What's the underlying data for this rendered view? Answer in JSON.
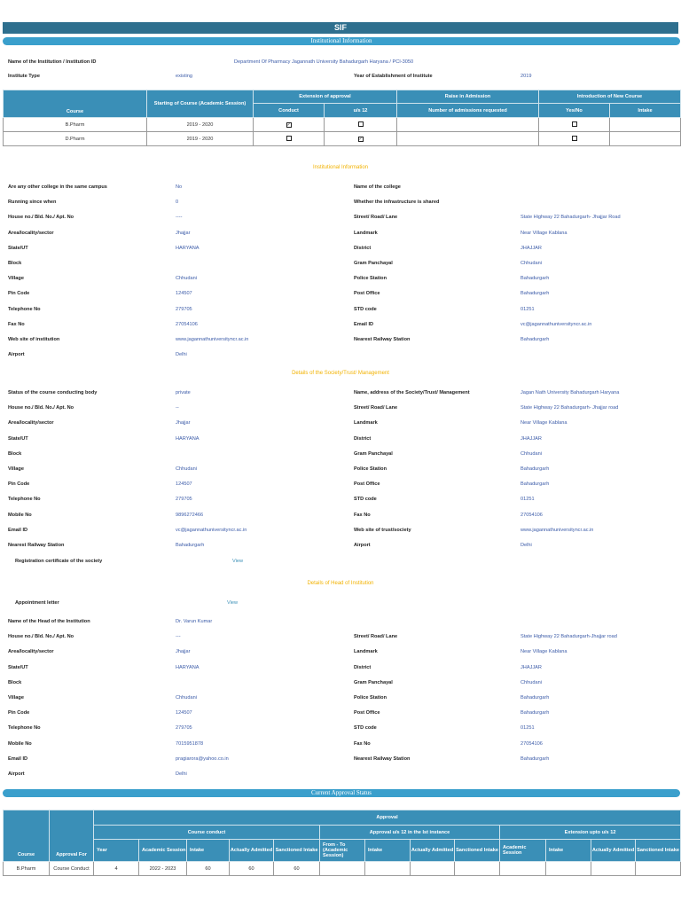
{
  "title": "SIF",
  "sections": {
    "inst_info_bar": "Institutional Information",
    "inst_info_heading": "Institutional Information",
    "society_heading": "Details of the Society/Trust/ Management",
    "head_heading": "Details of Head of Institution",
    "approval_bar": "Current Approval Status"
  },
  "top": {
    "name_label": "Name of the Institution / Institution ID",
    "name_value": "Department Of Pharmacy Jagannath University Bahadurgarh Haryana / PCI-3050",
    "type_label": "Institute Type",
    "type_value": "existing",
    "year_label": "Year of Establishment of Institute",
    "year_value": "2019"
  },
  "course_table": {
    "headers": {
      "course": "Course",
      "starting": "Starting of Course (Academic Session)",
      "extension": "Extension of approval",
      "raise": "Raise in Admission",
      "intro": "Introduction of New Course",
      "conduct": "Conduct",
      "us12": "u/s 12",
      "num": "Number of admissions requested",
      "yesno": "Yes/No",
      "intake": "Intake"
    },
    "rows": [
      {
        "course": "B.Pharm",
        "session": "2019 - 2020",
        "conduct": true,
        "us12": false,
        "num": "",
        "yesno": false,
        "intake": ""
      },
      {
        "course": "D.Pharm",
        "session": "2019 - 2020",
        "conduct": false,
        "us12": true,
        "num": "",
        "yesno": false,
        "intake": ""
      }
    ]
  },
  "inst_rows": [
    [
      "Are any other college in the same campus",
      "No",
      "Name of the college",
      ""
    ],
    [
      "Running since when",
      "0",
      "Whether the infrastructure is shared",
      ""
    ],
    [
      "House no./ Bld. No./ Apt. No",
      "----",
      "Street/ Road/ Lane",
      "State Highway 22 Bahadurgarh- Jhajjar Road"
    ],
    [
      "Area/locality/sector",
      "Jhajjar",
      "Landmark",
      "Near Village Kablana"
    ],
    [
      "State/UT",
      "HARYANA",
      "District",
      "JHAJJAR"
    ],
    [
      "Block",
      "",
      "Gram Panchayal",
      "Chhudani"
    ],
    [
      "Village",
      "Chhudani",
      "Police Station",
      "Bahadurgarh"
    ],
    [
      "Pin Code",
      "124507",
      "Post Office",
      "Bahadurgarh"
    ],
    [
      "Telephone No",
      "279705",
      "STD code",
      "01251"
    ],
    [
      "Fax No",
      "27054106",
      "Email ID",
      "vc@jagannathuniversityncr.ac.in"
    ],
    [
      "Web site of institution",
      "www.jagannathuniversityncr.ac.in",
      "Nearest Railway Station",
      "Bahadurgarh"
    ],
    [
      "Airport",
      "Delhi",
      "",
      ""
    ]
  ],
  "society_rows": [
    [
      "Status of the course conducting body",
      "private",
      "Name, address of the Society/Trust/ Management",
      "Jagan Nath University Bahadurgarh Haryana"
    ],
    [
      "House no./ Bld. No./ Apt. No",
      "--",
      "Street/ Road/ Lane",
      "State Highway 22 Bahadurgarh- Jhajjar road"
    ],
    [
      "Area/locality/sector",
      "Jhajjar",
      "Landmark",
      "Near Village Kablana"
    ],
    [
      "State/UT",
      "HARYANA",
      "District",
      "JHAJJAR"
    ],
    [
      "Block",
      "",
      "Gram Panchayal",
      "Chhudani"
    ],
    [
      "Village",
      "Chhudani",
      "Police Station",
      "Bahadurgarh"
    ],
    [
      "Pin Code",
      "124507",
      "Post Office",
      "Bahadurgarh"
    ],
    [
      "Telephone No",
      "279705",
      "STD code",
      "01251"
    ],
    [
      "Mobile No",
      "9896272466",
      "Fax No",
      "27054106"
    ],
    [
      "Email ID",
      "vc@jagannathuniversityncr.ac.in",
      "Web site of trust/society",
      "www.jagannathuniversityncr.ac.in"
    ],
    [
      "Nearest Railway Station",
      "Bahadurgarh",
      "Airport",
      "Delhi"
    ]
  ],
  "reg_cert": {
    "label": "Registration certificate of the society",
    "link": "View"
  },
  "appointment": {
    "label": "Appointment letter",
    "link": "View"
  },
  "head_rows": [
    [
      "Name of the Head of the Institution",
      "Dr. Varun Kumar",
      "",
      ""
    ],
    [
      "House no./ Bld. No./ Apt. No",
      "---",
      "Street/ Road/ Lane",
      "State Highway 22 Bahadurgarh-Jhajjar road"
    ],
    [
      "Area/locality/sector",
      "Jhajjar",
      "Landmark",
      "Near Village Kablana"
    ],
    [
      "State/UT",
      "HARYANA",
      "District",
      "JHAJJAR"
    ],
    [
      "Block",
      "",
      "Gram Panchayal",
      "Chhudani"
    ],
    [
      "Village",
      "Chhudani",
      "Police Station",
      "Bahadurgarh"
    ],
    [
      "Pin Code",
      "124507",
      "Post Office",
      "Bahadurgarh"
    ],
    [
      "Telephone No",
      "279705",
      "STD code",
      "01251"
    ],
    [
      "Mobile No",
      "7015951878",
      "Fax No",
      "27054106"
    ],
    [
      "Email ID",
      "pragiarora@yahoo.co.in",
      "Nearest Railway Station",
      "Bahadurgarh"
    ],
    [
      "Airport",
      "Delhi",
      "",
      ""
    ]
  ],
  "approval_table": {
    "headers": {
      "course": "Course",
      "approval_for": "Approval For",
      "approval": "Approval",
      "course_conduct": "Course conduct",
      "us12_first": "Approval u/s 12 in the Ist instance",
      "extension": "Extension upto u/s 12",
      "cols": [
        "Year",
        "Academic Session",
        "Intake",
        "Actually Admitted",
        "Sanctioned Intake",
        "From - To (Academic Session)",
        "Intake",
        "Actually Admitted",
        "Sanctioned Intake",
        "Academic Session",
        "Intake",
        "Actually Admitted",
        "Sanctioned Intake"
      ]
    },
    "rows": [
      {
        "cells": [
          "B.Pharm",
          "Course Conduct",
          "4",
          "2022 - 2023",
          "60",
          "60",
          "60",
          "",
          "",
          "",
          "",
          "",
          "",
          "",
          ""
        ]
      }
    ]
  }
}
